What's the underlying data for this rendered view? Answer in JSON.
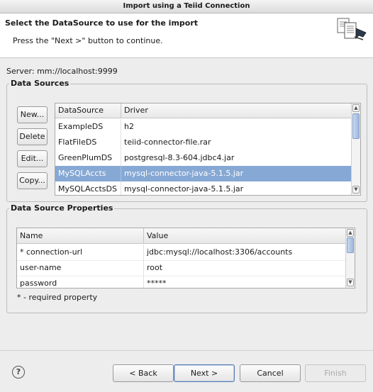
{
  "window": {
    "title": "Import using a Teiid Connection"
  },
  "header": {
    "title": "Select the DataSource to use for the import",
    "description": "Press the \"Next >\" button to continue."
  },
  "server_label": "Server: mm://localhost:9999",
  "data_sources": {
    "group_label": "Data Sources",
    "buttons": {
      "new": "New...",
      "delete": "Delete",
      "edit": "Edit...",
      "copy": "Copy..."
    },
    "columns": [
      "DataSource",
      "Driver"
    ],
    "rows": [
      {
        "name": "ExampleDS",
        "driver": "h2"
      },
      {
        "name": "FlatFileDS",
        "driver": "teiid-connector-file.rar"
      },
      {
        "name": "GreenPlumDS",
        "driver": "postgresql-8.3-604.jdbc4.jar"
      },
      {
        "name": "MySQLAccts",
        "driver": "mysql-connector-java-5.1.5.jar"
      },
      {
        "name": "MySQLAcctsDS",
        "driver": "mysql-connector-java-5.1.5.jar"
      }
    ],
    "selected_row": "MySQLAccts"
  },
  "properties": {
    "group_label": "Data Source Properties",
    "columns": [
      "Name",
      "Value"
    ],
    "rows": [
      {
        "name": "* connection-url",
        "value": "jdbc:mysql://localhost:3306/accounts"
      },
      {
        "name": "user-name",
        "value": "root"
      },
      {
        "name": "password",
        "value": "*****"
      }
    ],
    "note": "* - required property"
  },
  "footer": {
    "help_icon": "help-icon",
    "back": "< Back",
    "next": "Next >",
    "cancel": "Cancel",
    "finish": "Finish"
  },
  "colors": {
    "selection": "#86a8d4",
    "background": "#ededed"
  }
}
